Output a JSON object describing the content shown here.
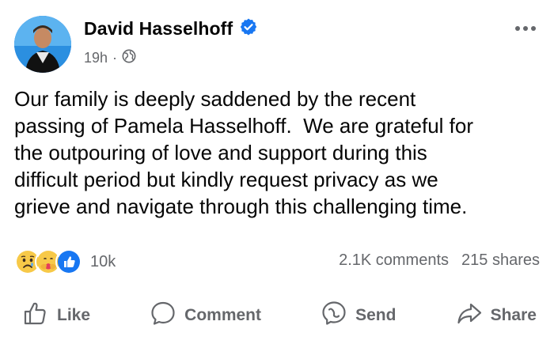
{
  "post": {
    "author": "David Hasselhoff",
    "time": "19h",
    "separator": "·",
    "text": "Our family is deeply saddened by the recent\npassing of Pamela Hasselhoff.  We are grateful for\nthe outpouring of love and support during this\ndifficult period but kindly request privacy as we\ngrieve and navigate through this challenging time.",
    "icons": {
      "verified": "verified-badge-icon",
      "audience": "globe-icon",
      "more": "more-options-icon"
    }
  },
  "stats": {
    "reaction_icons": [
      "sad-reaction-icon",
      "care-reaction-icon",
      "like-reaction-icon"
    ],
    "reactions_count": "10k",
    "comments": "2.1K comments",
    "shares": "215 shares"
  },
  "actions": {
    "like": "Like",
    "comment": "Comment",
    "send": "Send",
    "share": "Share"
  },
  "colors": {
    "brand_blue": "#1877f2",
    "muted_text": "#65676b",
    "text": "#050505"
  }
}
